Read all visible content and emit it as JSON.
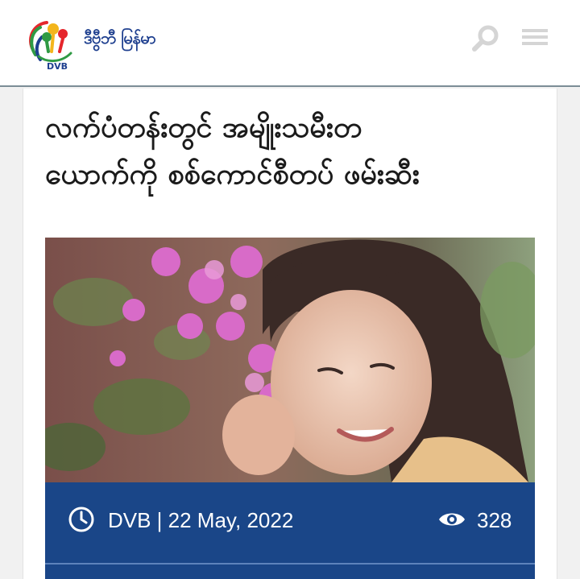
{
  "header": {
    "site_name": "ဒီဗွီဘီ မြန်မာ",
    "logo_text": "DVB",
    "search_icon": "search-icon",
    "menu_icon": "hamburger-menu-icon",
    "border_color": "#7c8d96"
  },
  "article": {
    "headline_line1": "လက်ပံတန်းတွင် အမျိုးသမီးတ",
    "headline_line2": "ယောက်ကို စစ်ကောင်စီတပ် ဖမ်းဆီး",
    "meta": {
      "clock_icon": "clock-icon",
      "byline": "DVB | 22 May, 2022",
      "views_icon": "eye-icon",
      "views": "328",
      "bar_color": "#1a4688"
    }
  }
}
